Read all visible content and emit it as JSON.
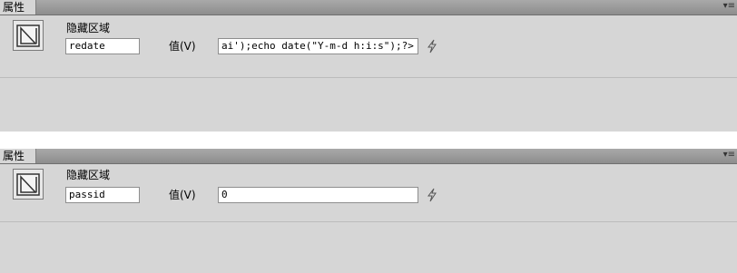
{
  "panels": [
    {
      "title": "属性",
      "element_type": "隐藏区域",
      "name_value": "redate",
      "value_label": "值(V)",
      "value_value": "ai');echo date(\"Y-m-d h:i:s\");?>"
    },
    {
      "title": "属性",
      "element_type": "隐藏区域",
      "name_value": "passid",
      "value_label": "值(V)",
      "value_value": "0"
    }
  ],
  "icons": {
    "panel_menu": "options-menu-icon",
    "hidden_field": "hidden-field-icon",
    "dynamic_data": "lightning-bolt-icon"
  },
  "menu_glyph": "▾≡"
}
